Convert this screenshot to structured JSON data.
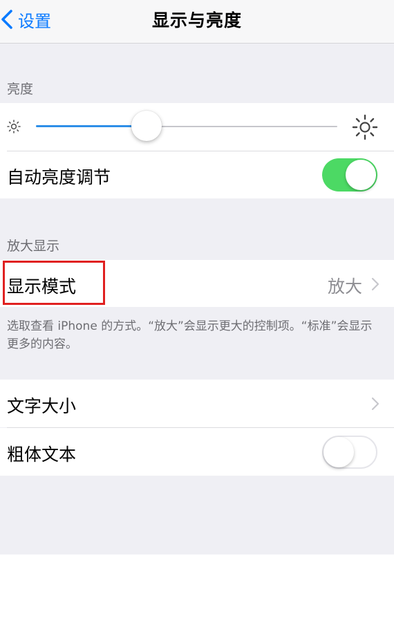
{
  "navbar": {
    "back_label": "设置",
    "title": "显示与亮度"
  },
  "brightness": {
    "header": "亮度",
    "level_percent": 36,
    "auto_label": "自动亮度调节",
    "auto_on": true
  },
  "zoom": {
    "header": "放大显示",
    "mode_label": "显示模式",
    "mode_value": "放大",
    "footer": "选取查看 iPhone 的方式。“放大”会显示更大的控制项。“标准”会显示更多的内容。"
  },
  "text": {
    "size_label": "文字大小",
    "bold_label": "粗体文本",
    "bold_on": false
  },
  "colors": {
    "accent_blue": "#0a7aff",
    "toggle_green": "#4cd964",
    "highlight_red": "#e02020"
  }
}
